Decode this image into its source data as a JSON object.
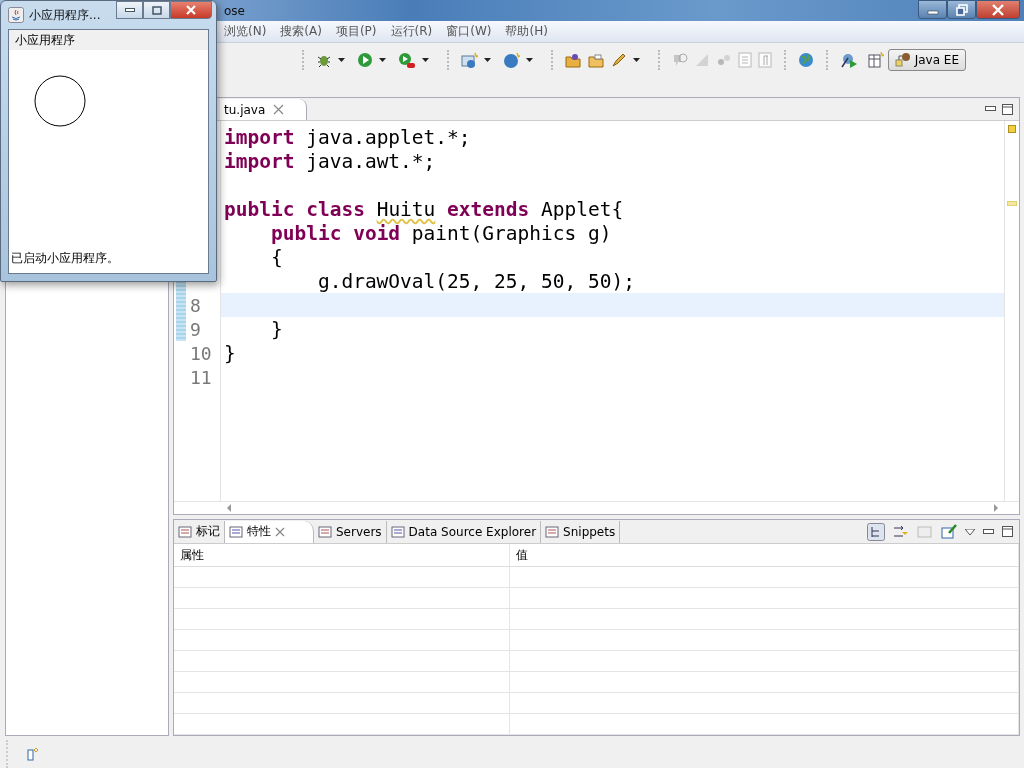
{
  "eclipse_window": {
    "title": "ose"
  },
  "menu": [
    "浏览(N)",
    "搜索(A)",
    "项目(P)",
    "运行(R)",
    "窗口(W)",
    "帮助(H)"
  ],
  "perspective": {
    "label": "Java EE",
    "selected": true
  },
  "editor": {
    "tab": {
      "label": "tu.java",
      "selected": true
    },
    "lines": [
      {
        "kind": "code",
        "tokens": [
          {
            "kind": "keyword",
            "text": "import"
          },
          {
            "kind": "plain",
            "text": " java.applet.*;"
          }
        ]
      },
      {
        "kind": "code",
        "tokens": [
          {
            "kind": "keyword",
            "text": "import"
          },
          {
            "kind": "plain",
            "text": " java.awt.*;"
          }
        ]
      },
      {
        "kind": "blank"
      },
      {
        "kind": "code",
        "tokens": [
          {
            "kind": "keyword",
            "text": "public"
          },
          {
            "kind": "keyword",
            "text": " class "
          },
          {
            "kind": "warning",
            "text": "Huitu"
          },
          {
            "kind": "keyword",
            "text": " extends"
          },
          {
            "kind": "plain",
            "text": " Applet{"
          }
        ]
      },
      {
        "kind": "code",
        "tokens": [
          {
            "kind": "keyword",
            "text": "    public"
          },
          {
            "kind": "keyword",
            "text": " void"
          },
          {
            "kind": "plain",
            "text": " paint(Graphics g)"
          }
        ]
      },
      {
        "kind": "code",
        "tokens": [
          {
            "kind": "plain",
            "text": "    {"
          }
        ]
      },
      {
        "kind": "code",
        "tokens": [
          {
            "kind": "plain",
            "text": "        g.drawOval(25, 25, 50, 50);"
          }
        ],
        "changed": true
      },
      {
        "kind": "blank",
        "number": "8",
        "current": true,
        "changed": true
      },
      {
        "kind": "code",
        "number": "9",
        "tokens": [
          {
            "kind": "plain",
            "text": "    }"
          }
        ],
        "changed": true
      },
      {
        "kind": "code",
        "number": "10",
        "tokens": [
          {
            "kind": "plain",
            "text": "}"
          }
        ]
      },
      {
        "kind": "blank",
        "number": "11"
      }
    ]
  },
  "bottom_panel": {
    "tabs": [
      {
        "label": "标记",
        "selected": false,
        "closable": false
      },
      {
        "label": "特性",
        "selected": true,
        "closable": true
      },
      {
        "label": "Servers",
        "selected": false,
        "closable": false
      },
      {
        "label": "Data Source Explorer",
        "selected": false,
        "closable": false
      },
      {
        "label": "Snippets",
        "selected": false,
        "closable": false
      }
    ],
    "table": {
      "columns": [
        "属性",
        "值"
      ]
    }
  },
  "applet_window": {
    "title": "小应用程序...",
    "menu": "小应用程序",
    "status": "已启动小应用程序。"
  }
}
